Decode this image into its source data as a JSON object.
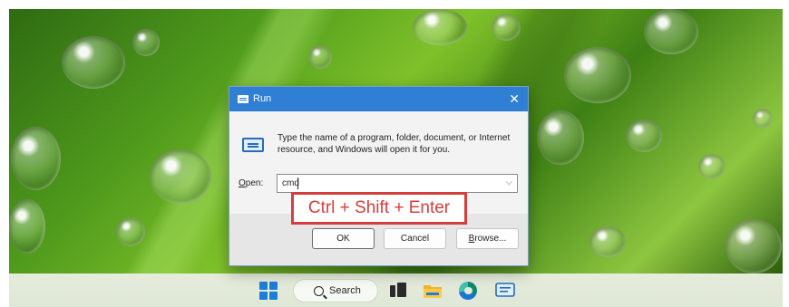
{
  "dialog": {
    "title": "Run",
    "close_glyph": "✕",
    "description": "Type the name of a program, folder, document, or Internet resource, and Windows will open it for you.",
    "open_label_accel": "O",
    "open_label_rest": "pen:",
    "input_value": "cmd",
    "dropdown_glyph": "⌵",
    "buttons": {
      "ok": "OK",
      "cancel": "Cancel",
      "browse_accel": "B",
      "browse_rest": "rowse..."
    }
  },
  "annotation": {
    "text": "Ctrl + Shift + Enter",
    "color": "#d63d3d"
  },
  "taskbar": {
    "search_label": "Search",
    "icons": [
      "start-icon",
      "search-icon",
      "task-view-icon",
      "file-explorer-icon",
      "edge-icon",
      "run-icon"
    ]
  },
  "colors": {
    "title_bar": "#2f7fd4",
    "taskbar": "#e3ebdb"
  }
}
